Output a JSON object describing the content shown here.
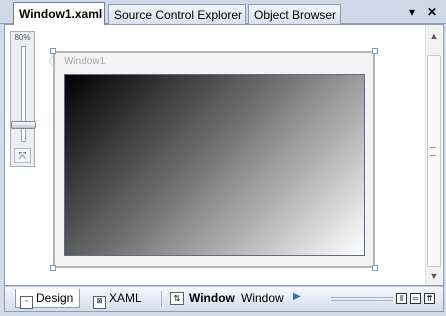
{
  "tabs": [
    {
      "label": "Window1.xaml",
      "active": true
    },
    {
      "label": "Source Control Explorer",
      "active": false
    },
    {
      "label": "Object Browser",
      "active": false
    }
  ],
  "tab_controls": {
    "dropdown_icon": "▾",
    "close_icon": "✕"
  },
  "zoom": {
    "label": "80%",
    "fit_icon": "⤧"
  },
  "designer": {
    "window_title": "Window1"
  },
  "scrollbar": {
    "up_icon": "▲",
    "down_icon": "▼"
  },
  "bottom": {
    "design_label": "Design",
    "xaml_label": "XAML",
    "swap_icon": "⇅",
    "breadcrumb_element": "Window",
    "breadcrumb_type": "Window",
    "breadcrumb_arrow": "▶",
    "split_vertical_icon": "‖",
    "split_horizontal_icon": "═",
    "collapse_icon": "⇈"
  }
}
